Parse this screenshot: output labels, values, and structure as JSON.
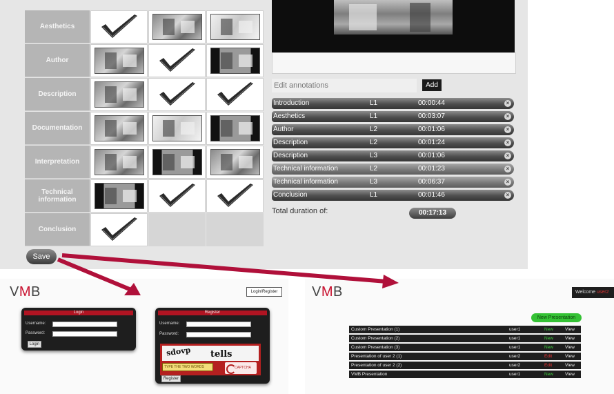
{
  "editor": {
    "grid_rows": [
      {
        "label": "Aesthetics",
        "cells": [
          "check",
          "thumb",
          "thumb-light"
        ]
      },
      {
        "label": "Author",
        "cells": [
          "thumb",
          "check",
          "thumb-dark"
        ]
      },
      {
        "label": "Description",
        "cells": [
          "thumb",
          "check",
          "check"
        ]
      },
      {
        "label": "Documentation",
        "cells": [
          "thumb",
          "thumb-light",
          "thumb-dark"
        ]
      },
      {
        "label": "Interpretation",
        "cells": [
          "thumb",
          "thumb-dark",
          "thumb"
        ]
      },
      {
        "label": "Technical information",
        "cells": [
          "thumb-dark",
          "check",
          "check"
        ]
      },
      {
        "label": "Conclusion",
        "cells": [
          "check",
          "empty",
          "empty"
        ]
      }
    ],
    "annotations_placeholder": "Edit annotations",
    "add_label": "Add",
    "segments": [
      {
        "name": "Introduction",
        "level": "L1",
        "time": "00:00:44"
      },
      {
        "name": "Aesthetics",
        "level": "L1",
        "time": "00:03:07"
      },
      {
        "name": "Author",
        "level": "L2",
        "time": "00:01:06"
      },
      {
        "name": "Description",
        "level": "L2",
        "time": "00:01:24"
      },
      {
        "name": "Description",
        "level": "L3",
        "time": "00:01:06"
      },
      {
        "name": "Technical information",
        "level": "L2",
        "time": "00:01:23"
      },
      {
        "name": "Technical information",
        "level": "L3",
        "time": "00:06:37"
      },
      {
        "name": "Conclusion",
        "level": "L1",
        "time": "00:01:46"
      }
    ],
    "total_label": "Total duration of:",
    "total_value": "00:17:13",
    "save_label": "Save",
    "close_glyph": "×"
  },
  "login_screen": {
    "logo_v": "V",
    "logo_m": "M",
    "logo_b": "B",
    "login_register_label": "Login/Register",
    "login_panel": {
      "title": "Login",
      "username_label": "Username:",
      "password_label": "Password:",
      "button_label": "Login"
    },
    "register_panel": {
      "title": "Register",
      "username_label": "Username:",
      "password_label": "Password:",
      "captcha_word_1": "sdovp",
      "captcha_word_2": "tells",
      "captcha_input_placeholder": "TYPE THE TWO WORDS",
      "captcha_brand": "CAPTCHA",
      "button_label": "Register"
    }
  },
  "list_screen": {
    "logo_v": "V",
    "logo_m": "M",
    "logo_b": "B",
    "welcome_text": "Welcome",
    "welcome_user": "user2",
    "new_presentation_label": "New Presentation",
    "presentations": [
      {
        "title": "Custom Presentation (1)",
        "owner": "user1",
        "action": "New",
        "view": "View"
      },
      {
        "title": "Custom Presentation (2)",
        "owner": "user1",
        "action": "New",
        "view": "View"
      },
      {
        "title": "Custom Presentation (3)",
        "owner": "user1",
        "action": "New",
        "view": "View"
      },
      {
        "title": "Presentation of user 2 (1)",
        "owner": "user2",
        "action": "Edit",
        "view": "View"
      },
      {
        "title": "Presentation of user 2 (2)",
        "owner": "user2",
        "action": "Edit",
        "view": "View"
      },
      {
        "title": "VMB Presentation",
        "owner": "user1",
        "action": "New",
        "view": "View"
      }
    ]
  },
  "colors": {
    "accent_red": "#c8102e",
    "arrow": "#b0103a",
    "new_green": "#3ecf3e",
    "edit_red": "#ee3333"
  }
}
